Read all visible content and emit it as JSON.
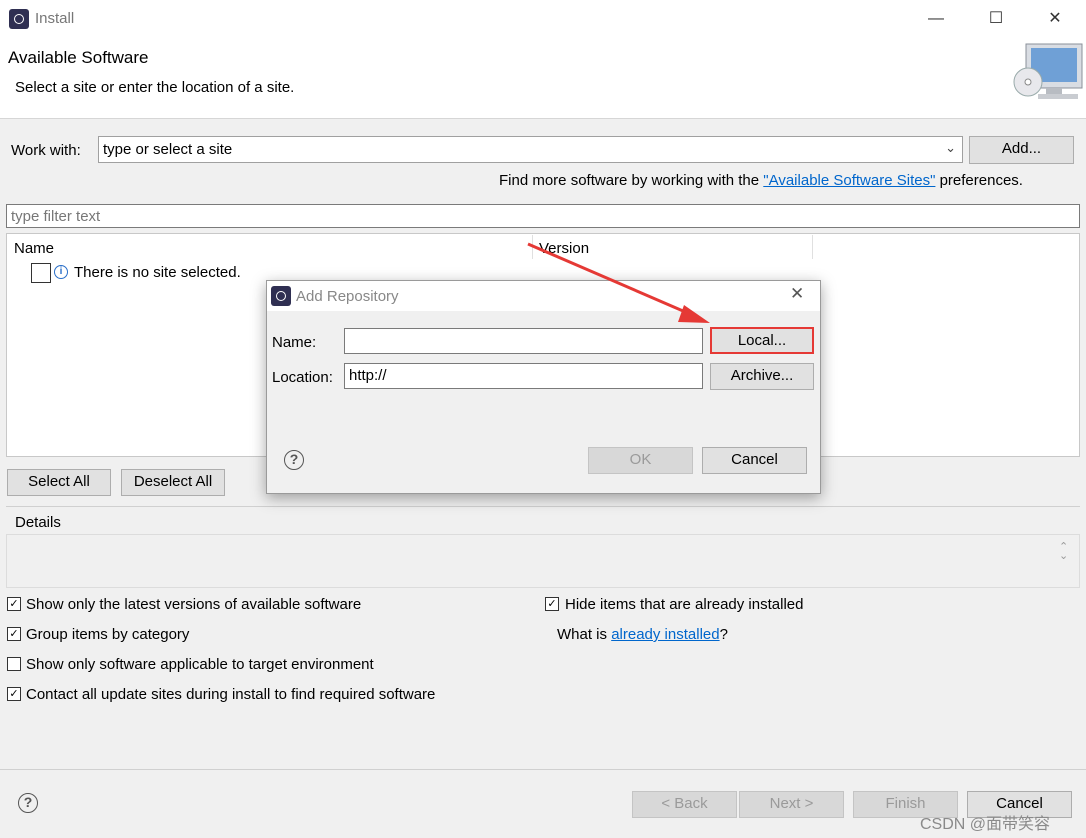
{
  "window": {
    "title": "Install"
  },
  "header": {
    "title": "Available Software",
    "subtitle": "Select a site or enter the location of a site."
  },
  "work_with": {
    "label": "Work with:",
    "value": "type or select a site",
    "add_button": "Add..."
  },
  "find_more": {
    "prefix": "Find more software by working with the ",
    "link": "\"Available Software Sites\"",
    "suffix": " preferences."
  },
  "filter": {
    "placeholder": "type filter text"
  },
  "table": {
    "columns": [
      "Name",
      "Version"
    ],
    "rows": [
      {
        "name": "There is no site selected.",
        "checked": false
      }
    ]
  },
  "selection_buttons": {
    "select_all": "Select All",
    "deselect_all": "Deselect All"
  },
  "details": {
    "label": "Details"
  },
  "options": [
    {
      "label": "Show only the latest versions of available software",
      "checked": true
    },
    {
      "label": "Group items by category",
      "checked": true
    },
    {
      "label": "Show only software applicable to target environment",
      "checked": false
    },
    {
      "label": "Contact all update sites during install to find required software",
      "checked": true
    },
    {
      "label": "Hide items that are already installed",
      "checked": true
    }
  ],
  "what_is": {
    "prefix": "What is ",
    "link": "already installed",
    "suffix": "?"
  },
  "footer": {
    "back": "< Back",
    "next": "Next >",
    "finish": "Finish",
    "cancel": "Cancel"
  },
  "dialog": {
    "title": "Add Repository",
    "name_label": "Name:",
    "name_value": "",
    "location_label": "Location:",
    "location_value": "http://",
    "local_button": "Local...",
    "archive_button": "Archive...",
    "ok_button": "OK",
    "cancel_button": "Cancel"
  },
  "annotation": {
    "highlight_color": "#e53935"
  },
  "watermark": "CSDN @面带笑容"
}
